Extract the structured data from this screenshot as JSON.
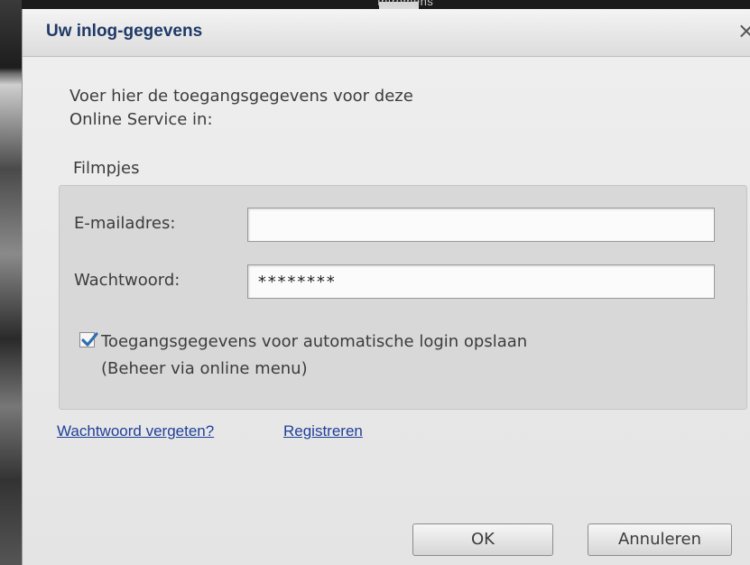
{
  "background": {
    "top_text": "Intromens"
  },
  "dialog": {
    "title": "Uw inlog-gegevens",
    "close_glyph": "×",
    "intro_text": "Voer hier de toegangsgegevens voor deze\nOnline Service in:",
    "group_label": "Filmpjes",
    "email": {
      "label": "E-mailadres:",
      "value": ""
    },
    "password": {
      "label": "Wachtwoord:",
      "value": "********"
    },
    "remember": {
      "checked": true,
      "label": "Toegangsgegevens voor automatische login opslaan\n(Beheer via online menu)"
    },
    "links": {
      "forgot": "Wachtwoord vergeten?",
      "register": "Registreren"
    },
    "buttons": {
      "ok": "OK",
      "cancel": "Annuleren"
    }
  },
  "colors": {
    "title": "#1f3a68",
    "link": "#1f3f9a",
    "check": "#2f6fb0"
  },
  "icons": {
    "close": "close-icon",
    "check": "checkmark-icon"
  }
}
